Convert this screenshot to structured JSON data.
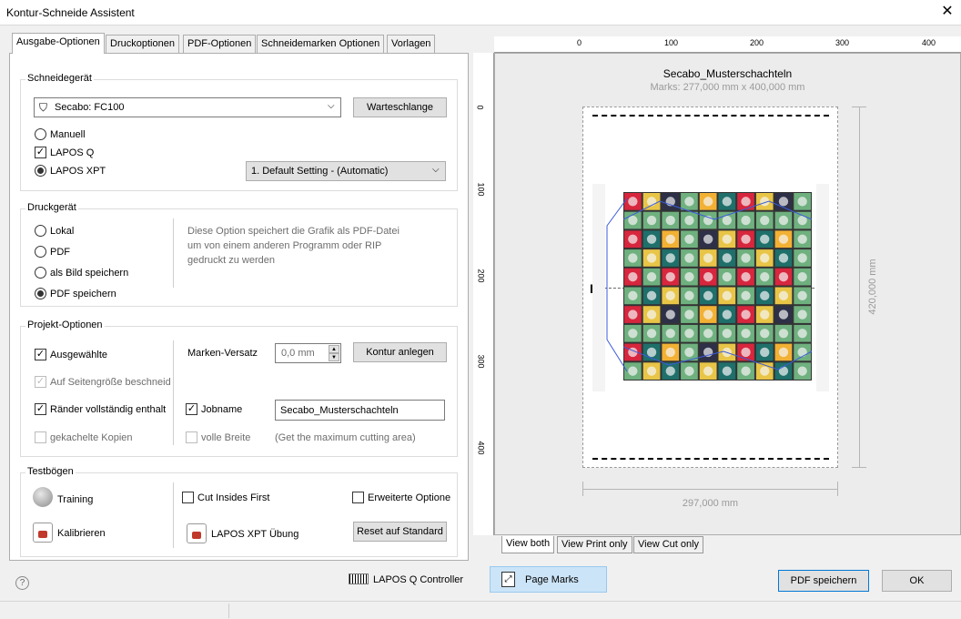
{
  "window": {
    "title": "Kontur-Schneide Assistent",
    "close_glyph": "✕"
  },
  "tabs": [
    "Ausgabe-Optionen",
    "Druckoptionen",
    "PDF-Optionen",
    "Schneidemarken Optionen",
    "Vorlagen"
  ],
  "schneidegeraet": {
    "group_title": "Schneidegerät",
    "device": "Secabo: FC100",
    "queue_button": "Warteschlange",
    "options": [
      "Manuell",
      "LAPOS Q",
      "LAPOS XPT"
    ],
    "lapos_q_checked": true,
    "selected_option": "LAPOS XPT",
    "setting": "1. Default Setting - (Automatic)"
  },
  "druckgeraet": {
    "group_title": "Druckgerät",
    "options": [
      "Lokal",
      "PDF",
      "als Bild speichern",
      "PDF speichern"
    ],
    "selected": "PDF speichern",
    "description": [
      "Diese Option speichert die Grafik als PDF-Datei",
      "um von einem anderen Programm oder RIP",
      "gedruckt zu werden"
    ]
  },
  "projekt": {
    "group_title": "Projekt-Optionen",
    "ausgewaehlte": "Ausgewählte",
    "auf_seitengroesse": "Auf Seitengröße beschneid",
    "raender": "Ränder vollständig enthalt",
    "gekachelte": "gekachelte Kopien",
    "marken_versatz_label": "Marken-Versatz",
    "marken_versatz_value": "0,0 mm",
    "kontur_button": "Kontur anlegen",
    "jobname_label": "Jobname",
    "jobname_value": "Secabo_Musterschachteln",
    "volle_breite": "volle Breite",
    "volle_breite_hint": "(Get the maximum cutting area)"
  },
  "testboegen": {
    "group_title": "Testbögen",
    "training": "Training",
    "kalibrieren": "Kalibrieren",
    "cut_insides": "Cut Insides First",
    "erweiterte": "Erweiterte Optione",
    "lapos_xpt_uebung": "LAPOS XPT Übung",
    "reset_button": "Reset auf Standard"
  },
  "preview": {
    "job_title": "Secabo_Musterschachteln",
    "marks_text": "Marks: 277,000 mm x 400,000 mm",
    "width_label": "297,000 mm",
    "height_label": "420,000 mm",
    "ruler_top": [
      "0",
      "100",
      "200",
      "300",
      "400"
    ],
    "ruler_left": [
      "0",
      "100",
      "200",
      "300",
      "400"
    ],
    "view_tabs": [
      "View both",
      "View Print only",
      "View Cut only"
    ]
  },
  "footer": {
    "help_glyph": "?",
    "lapos_controller": "LAPOS Q Controller",
    "page_marks": "Page Marks",
    "pdf_button": "PDF speichern",
    "ok_button": "OK"
  },
  "colors": {
    "tile_palette": [
      "#d7263d",
      "#1f6f6b",
      "#f2b134",
      "#6fb07f",
      "#2d3047",
      "#e8c547"
    ],
    "active_blue": "#cce4f7"
  }
}
